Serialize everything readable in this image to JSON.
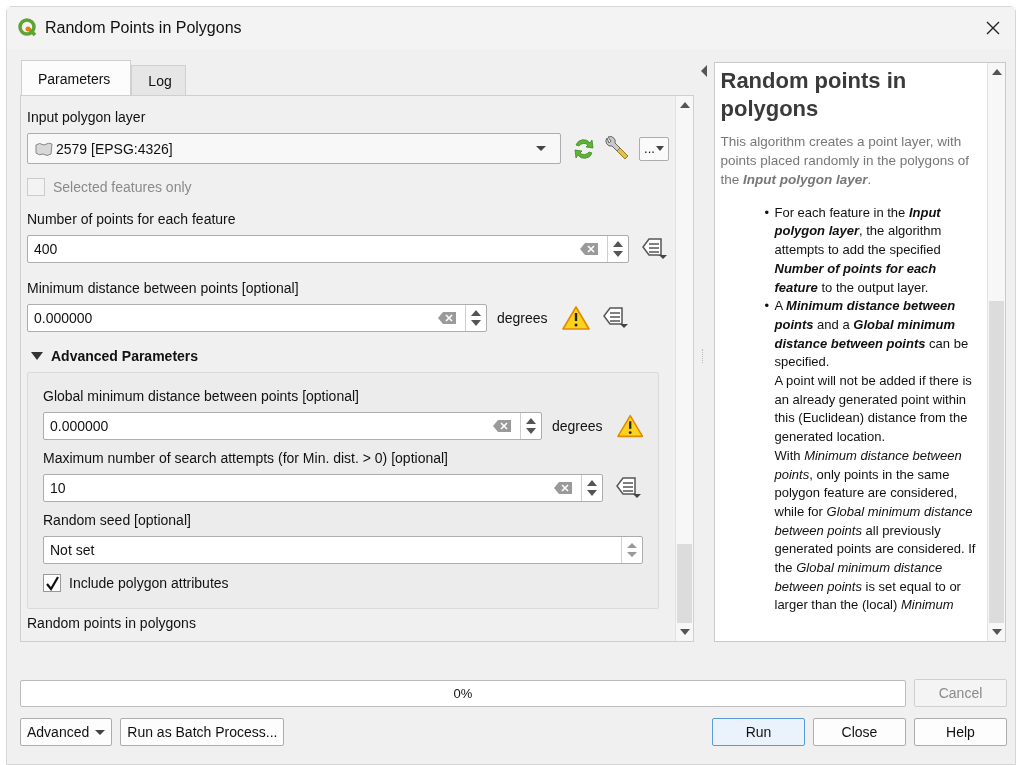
{
  "window": {
    "title": "Random Points in Polygons"
  },
  "tabs": [
    {
      "label": "Parameters",
      "selected": true
    },
    {
      "label": "Log",
      "selected": false
    }
  ],
  "parameters": [
    {
      "kind": "layer",
      "label": "Input polygon layer",
      "value": "2579 [EPSG:4326]",
      "more": "..."
    },
    {
      "kind": "checkbox",
      "label": "Selected features only",
      "checked": false,
      "disabled": true
    },
    {
      "kind": "number",
      "label": "Number of points for each feature",
      "value": "400",
      "data_defined": true
    },
    {
      "kind": "number",
      "label": "Minimum distance between points [optional]",
      "value": "0.000000",
      "unit": "degrees",
      "warning": true,
      "data_defined": true
    },
    {
      "kind": "group",
      "label": "Advanced Parameters",
      "expanded": true,
      "children": [
        {
          "kind": "number",
          "label": "Global minimum distance between points [optional]",
          "value": "0.000000",
          "unit": "degrees",
          "warning": true,
          "data_defined": false
        },
        {
          "kind": "number",
          "label": "Maximum number of search attempts (for Min. dist. > 0) [optional]",
          "value": "10",
          "data_defined": true
        },
        {
          "kind": "seed",
          "label": "Random seed [optional]",
          "value": "Not set"
        },
        {
          "kind": "checkbox",
          "label": "Include polygon attributes",
          "checked": true,
          "disabled": false
        }
      ]
    },
    {
      "kind": "caption",
      "label": "Random points in polygons"
    }
  ],
  "help": {
    "title": "Random points in polygons",
    "intro": "This algorithm creates a point layer, with points placed randomly in the polygons of the **Input polygon layer**.",
    "bullets": [
      {
        "marker": "•",
        "paragraphs": [
          "For each feature in the **Input polygon layer**, the algorithm attempts to add the specified **Number of points for each feature** to the output layer."
        ]
      },
      {
        "marker": "•",
        "paragraphs": [
          "A **Minimum distance between points** and a **Global minimum distance between points** can be specified.",
          "A point will not be added if there is an already generated point within this (Euclidean) distance from the generated location.",
          "With *Minimum distance between points*, only points in the same polygon feature are considered, while for *Global minimum distance between points* all previously generated points are considered. If the *Global minimum distance between points* is set equal to or larger than the (local) *Minimum*"
        ]
      }
    ]
  },
  "progress": {
    "level": 0,
    "text": "0%"
  },
  "cancel": {
    "label": "Cancel",
    "disabled": true
  },
  "footer_left": [
    {
      "label": "Advanced",
      "kind": "menu"
    },
    {
      "label": "Run as Batch Process...",
      "kind": "plain"
    }
  ],
  "footer_right": [
    {
      "label": "Run",
      "default": true
    },
    {
      "label": "Close",
      "default": false
    },
    {
      "label": "Help",
      "default": false
    }
  ]
}
